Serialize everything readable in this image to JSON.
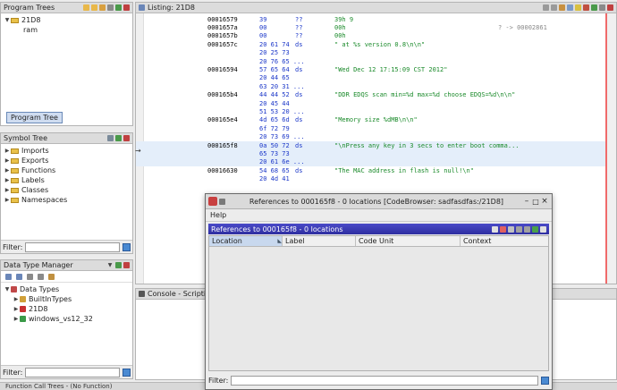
{
  "program_trees": {
    "title": "Program Trees",
    "root": "21D8",
    "child": "ram",
    "tab": "Program Tree"
  },
  "symbol_tree": {
    "title": "Symbol Tree",
    "items": [
      "Imports",
      "Exports",
      "Functions",
      "Labels",
      "Classes",
      "Namespaces"
    ],
    "filter_label": "Filter:"
  },
  "dtm": {
    "title": "Data Type Manager",
    "root": "Data Types",
    "items": [
      "BuiltInTypes",
      "21D8",
      "windows_vs12_32"
    ],
    "filter_label": "Filter:"
  },
  "console": {
    "title": "Console - Scripting"
  },
  "status": {
    "text": "Function Call Trees - (No Function)"
  },
  "listing": {
    "title": "Listing: 21D8",
    "rows": [
      {
        "addr": "00016579",
        "bytes": "39",
        "mnem": "??",
        "op": "39h     9",
        "comment": ""
      },
      {
        "addr": "0001657a",
        "bytes": "00",
        "mnem": "??",
        "op": "00h",
        "comment": "?  ->  00002861"
      },
      {
        "addr": "0001657b",
        "bytes": "00",
        "mnem": "??",
        "op": "00h",
        "comment": ""
      },
      {
        "addr": "0001657c",
        "bytes": "20 61 74",
        "mnem": "ds",
        "op": "\" at %s version 0.8\\n\\n\"",
        "comment": ""
      },
      {
        "addr": "",
        "bytes": "20 25 73",
        "mnem": "",
        "op": "",
        "comment": ""
      },
      {
        "addr": "",
        "bytes": "20 76 65 ...",
        "mnem": "",
        "op": "",
        "comment": ""
      },
      {
        "addr": "00016594",
        "bytes": "57 65 64",
        "mnem": "ds",
        "op": "\"Wed Dec 12 17:15:09 CST 2012\"",
        "comment": ""
      },
      {
        "addr": "",
        "bytes": "20 44 65",
        "mnem": "",
        "op": "",
        "comment": ""
      },
      {
        "addr": "",
        "bytes": "63 20 31 ...",
        "mnem": "",
        "op": "",
        "comment": ""
      },
      {
        "addr": "000165b4",
        "bytes": "44 44 52",
        "mnem": "ds",
        "op": "\"DDR EDQS scan min=%d max=%d choose EDQS=%d\\n\\n\"",
        "comment": ""
      },
      {
        "addr": "",
        "bytes": "20 45 44",
        "mnem": "",
        "op": "",
        "comment": ""
      },
      {
        "addr": "",
        "bytes": "51 53 20 ...",
        "mnem": "",
        "op": "",
        "comment": ""
      },
      {
        "addr": "000165e4",
        "bytes": "4d 65 6d",
        "mnem": "ds",
        "op": "\"Memory size %dMB\\n\\n\"",
        "comment": ""
      },
      {
        "addr": "",
        "bytes": "6f 72 79",
        "mnem": "",
        "op": "",
        "comment": ""
      },
      {
        "addr": "",
        "bytes": "20 73 69 ...",
        "mnem": "",
        "op": "",
        "comment": ""
      },
      {
        "addr": "000165f8",
        "bytes": "0a 50 72",
        "mnem": "ds",
        "op": "\"\\nPress any key in 3 secs to enter boot comma...",
        "comment": ""
      },
      {
        "addr": "",
        "bytes": "65 73 73",
        "mnem": "",
        "op": "",
        "comment": ""
      },
      {
        "addr": "",
        "bytes": "20 61 6e ...",
        "mnem": "",
        "op": "",
        "comment": ""
      },
      {
        "addr": "00016630",
        "bytes": "54 68 65",
        "mnem": "ds",
        "op": "\"The MAC address in flash is null!\\n\"",
        "comment": ""
      },
      {
        "addr": "",
        "bytes": "20 4d 41",
        "mnem": "",
        "op": "",
        "comment": ""
      }
    ]
  },
  "refs": {
    "window_title": "References to 000165f8 - 0 locations [CodeBrowser: sadfasdfas:/21D8]",
    "menu_help": "Help",
    "subtitle": "References to 000165f8 - 0 locations",
    "columns": [
      "Location",
      "Label",
      "Code Unit",
      "Context"
    ],
    "filter_label": "Filter:"
  },
  "colors": {
    "accent": "#3a3ab8",
    "string": "#1a8a2a",
    "address": "#1a36c8"
  }
}
